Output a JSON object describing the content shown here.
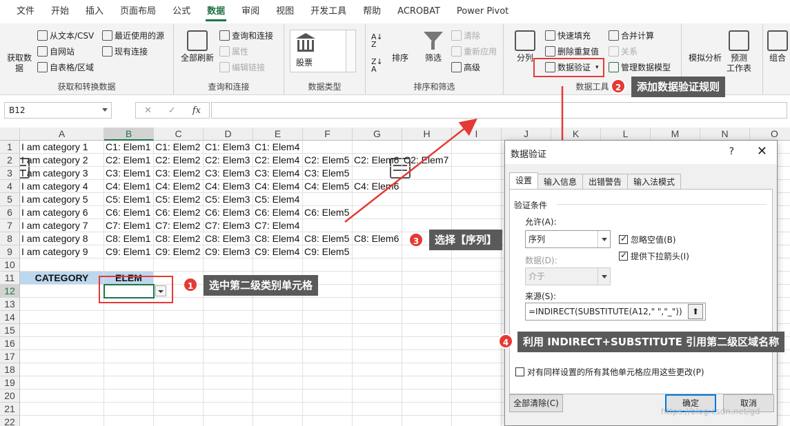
{
  "menu": {
    "tabs": [
      "文件",
      "开始",
      "插入",
      "页面布局",
      "公式",
      "数据",
      "审阅",
      "视图",
      "开发工具",
      "帮助",
      "ACROBAT",
      "Power Pivot"
    ],
    "active": "数据"
  },
  "ribbon": {
    "get_data": {
      "big_label_1": "获取数",
      "big_label_2": "据",
      "from_csv": "从文本/CSV",
      "from_web": "自网站",
      "from_table": "自表格/区域",
      "recent": "最近使用的源",
      "existing": "现有连接",
      "group": "获取和转换数据"
    },
    "queries": {
      "refresh": "全部刷新",
      "queries_conn": "查询和连接",
      "properties": "属性",
      "edit_links": "编辑链接",
      "group": "查询和连接"
    },
    "datatypes": {
      "stock": "股票",
      "group": "数据类型"
    },
    "sort": {
      "sort": "排序",
      "filter": "筛选",
      "clear": "清除",
      "reapply": "重新应用",
      "advanced": "高级",
      "group": "排序和筛选"
    },
    "tools": {
      "split": "分列",
      "flash_fill": "快速填充",
      "remove_dup": "删除重复值",
      "validation": "数据验证",
      "consolidate": "合并计算",
      "relations": "关系",
      "model": "管理数据模型",
      "group": "数据工具"
    },
    "forecast": {
      "whatif": "模拟分析",
      "forecast_1": "预测",
      "forecast_2": "工作表",
      "outline": "组合"
    }
  },
  "formula_bar": {
    "name_box": "B12",
    "fx": "fx",
    "x": "✕",
    "check": "✓",
    "value": ""
  },
  "sheet": {
    "columns": [
      "A",
      "B",
      "C",
      "D",
      "E",
      "F",
      "G",
      "H",
      "I",
      "J",
      "K",
      "L",
      "M",
      "N",
      "O"
    ],
    "rows": [
      "1",
      "2",
      "3",
      "4",
      "5",
      "6",
      "7",
      "8",
      "9",
      "10",
      "11",
      "12",
      "13",
      "14",
      "15",
      "16",
      "17",
      "18",
      "19",
      "20",
      "21",
      "22"
    ],
    "data": [
      [
        "I am category 1",
        "C1: Elem1",
        "C1: Elem2",
        "C1: Elem3",
        "C1: Elem4",
        "",
        "",
        ""
      ],
      [
        "I am category 2",
        "C2: Elem1",
        "C2: Elem2",
        "C2: Elem3",
        "C2: Elem4",
        "C2: Elem5",
        "C2: Elem6",
        "C2: Elem7"
      ],
      [
        "I am category 3",
        "C3: Elem1",
        "C3: Elem2",
        "C3: Elem3",
        "C3: Elem4",
        "C3: Elem5",
        "",
        ""
      ],
      [
        "I am category 4",
        "C4: Elem1",
        "C4: Elem2",
        "C4: Elem3",
        "C4: Elem4",
        "C4: Elem5",
        "C4: Elem6",
        ""
      ],
      [
        "I am category 5",
        "C5: Elem1",
        "C5: Elem2",
        "C5: Elem3",
        "C5: Elem4",
        "",
        "",
        ""
      ],
      [
        "I am category 6",
        "C6: Elem1",
        "C6: Elem2",
        "C6: Elem3",
        "C6: Elem4",
        "C6: Elem5",
        "",
        ""
      ],
      [
        "I am category 7",
        "C7: Elem1",
        "C7: Elem2",
        "C7: Elem3",
        "C7: Elem4",
        "",
        "",
        ""
      ],
      [
        "I am category 8",
        "C8: Elem1",
        "C8: Elem2",
        "C8: Elem3",
        "C8: Elem4",
        "C8: Elem5",
        "C8: Elem6",
        ""
      ],
      [
        "I am category 9",
        "C9: Elem1",
        "C9: Elem2",
        "C9: Elem3",
        "C9: Elem4",
        "C9: Elem5",
        "",
        ""
      ]
    ],
    "header_category": "CATEGORY",
    "header_elem": "ELEM"
  },
  "annotations": {
    "step1": {
      "num": "1",
      "text": "选中第二级类别单元格"
    },
    "step2": {
      "num": "2",
      "text": "添加数据验证规则"
    },
    "step3": {
      "num": "3",
      "text": "选择【序列】"
    },
    "step4": {
      "num": "4",
      "text": "利用 INDIRECT+SUBSTITUTE 引用第二级区域名称"
    }
  },
  "dialog": {
    "title": "数据验证",
    "help": "?",
    "close": "✕",
    "tabs": [
      "设置",
      "输入信息",
      "出错警告",
      "输入法模式"
    ],
    "section": "验证条件",
    "allow_label": "允许(A):",
    "allow_value": "序列",
    "ignore_blank": "忽略空值(B)",
    "dropdown": "提供下拉箭头(I)",
    "data_label": "数据(D):",
    "data_value": "介于",
    "source_label": "来源(S):",
    "source_value": "=INDIRECT(SUBSTITUTE(A12,\" \",\"_\"))",
    "apply_all": "对有同样设置的所有其他单元格应用这些更改(P)",
    "clear_all": "全部清除(C)",
    "ok": "确定",
    "cancel": "取消"
  },
  "watermark": "https://blog.csdn.net/gd"
}
